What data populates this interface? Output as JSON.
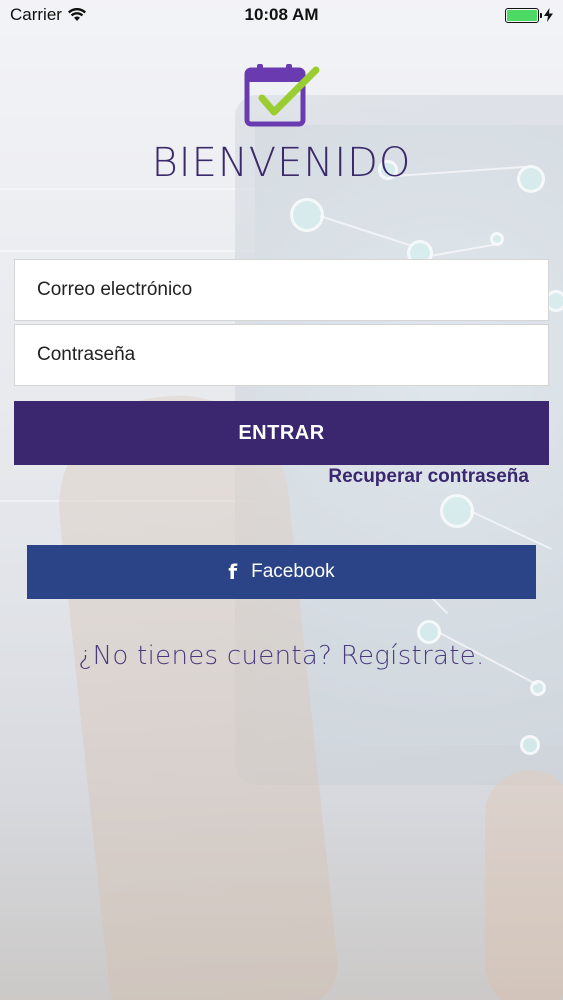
{
  "status_bar": {
    "carrier": "Carrier",
    "time": "10:08 AM",
    "battery_level": 1.0,
    "charging": true
  },
  "header": {
    "logo_icon": "calendar-check-icon",
    "title": "BIENVENIDO"
  },
  "form": {
    "email_label": "Correo electrónico",
    "password_label": "Contraseña",
    "submit_label": "ENTRAR",
    "recover_label": "Recuperar contraseña"
  },
  "social": {
    "facebook_icon": "f",
    "facebook_label": "Facebook"
  },
  "footer": {
    "signup_label": "¿No tienes cuenta? Regístrate."
  },
  "colors": {
    "brand": "#3a2770",
    "facebook": "#2b4488",
    "accent_check": "#9acd32",
    "battery": "#4cd964"
  }
}
